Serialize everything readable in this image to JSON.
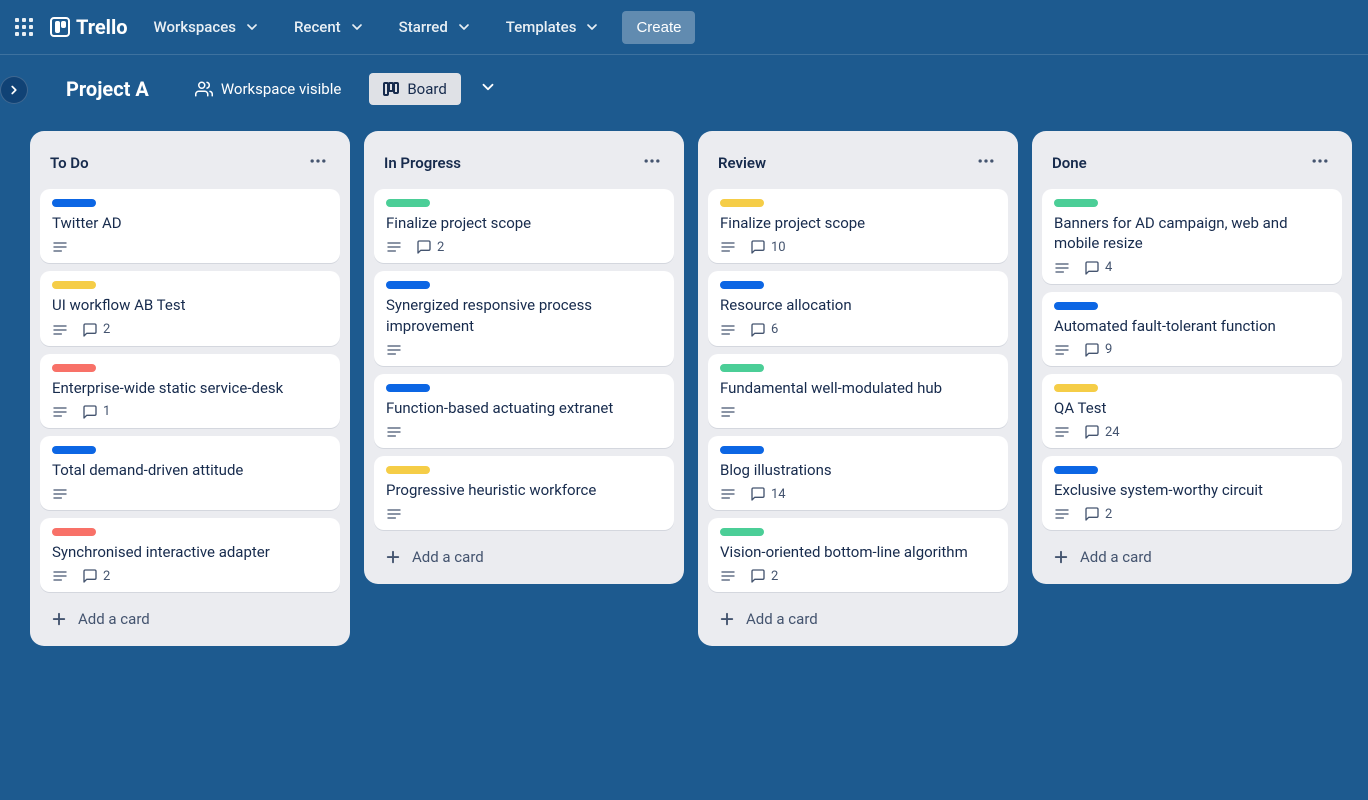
{
  "topbar": {
    "logo_text": "Trello",
    "nav": [
      "Workspaces",
      "Recent",
      "Starred",
      "Templates"
    ],
    "create_label": "Create"
  },
  "board_header": {
    "title": "Project A",
    "visibility_label": "Workspace visible",
    "view_label": "Board"
  },
  "label_colors": {
    "blue": "lbl-blue",
    "yellow": "lbl-yellow",
    "red": "lbl-red",
    "green": "lbl-green"
  },
  "add_card_label": "Add a card",
  "lists": [
    {
      "title": "To Do",
      "cards": [
        {
          "label": "blue",
          "title": "Twitter AD",
          "has_desc": true
        },
        {
          "label": "yellow",
          "title": "UI workflow AB Test",
          "has_desc": true,
          "comments": 2
        },
        {
          "label": "red",
          "title": "Enterprise-wide static service-desk",
          "has_desc": true,
          "comments": 1
        },
        {
          "label": "blue",
          "title": "Total demand-driven attitude",
          "has_desc": true
        },
        {
          "label": "red",
          "title": "Synchronised interactive adapter",
          "has_desc": true,
          "comments": 2
        }
      ]
    },
    {
      "title": "In Progress",
      "cards": [
        {
          "label": "green",
          "title": "Finalize project scope",
          "has_desc": true,
          "comments": 2
        },
        {
          "label": "blue",
          "title": "Synergized responsive process improvement",
          "has_desc": true
        },
        {
          "label": "blue",
          "title": "Function-based actuating extranet",
          "has_desc": true
        },
        {
          "label": "yellow",
          "title": "Progressive heuristic workforce",
          "has_desc": true
        }
      ]
    },
    {
      "title": "Review",
      "cards": [
        {
          "label": "yellow",
          "title": "Finalize project scope",
          "has_desc": true,
          "comments": 10
        },
        {
          "label": "blue",
          "title": "Resource allocation",
          "has_desc": true,
          "comments": 6
        },
        {
          "label": "green",
          "title": "Fundamental well-modulated hub",
          "has_desc": true
        },
        {
          "label": "blue",
          "title": "Blog illustrations",
          "has_desc": true,
          "comments": 14
        },
        {
          "label": "green",
          "title": "Vision-oriented bottom-line algorithm",
          "has_desc": true,
          "comments": 2
        }
      ]
    },
    {
      "title": "Done",
      "cards": [
        {
          "label": "green",
          "title": "Banners for AD campaign, web and mobile resize",
          "has_desc": true,
          "comments": 4
        },
        {
          "label": "blue",
          "title": "Automated fault-tolerant function",
          "has_desc": true,
          "comments": 9
        },
        {
          "label": "yellow",
          "title": "QA Test",
          "has_desc": true,
          "comments": 24
        },
        {
          "label": "blue",
          "title": "Exclusive system-worthy circuit",
          "has_desc": true,
          "comments": 2
        }
      ]
    }
  ]
}
